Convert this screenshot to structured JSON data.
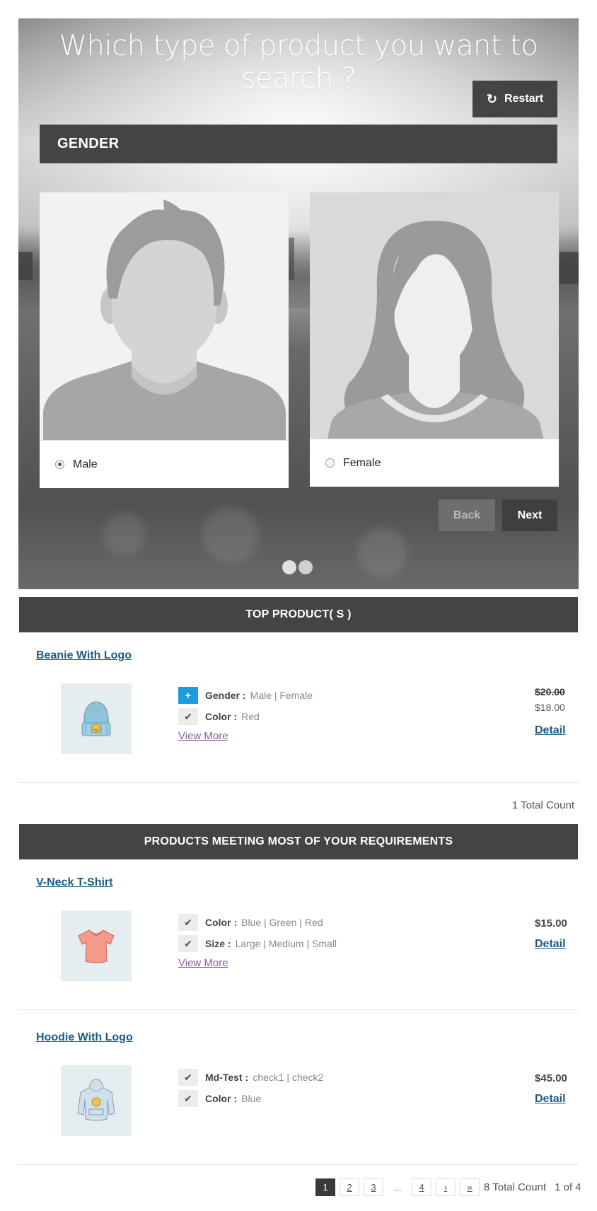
{
  "wizard": {
    "title": "Which type of product you want to search ?",
    "restart_label": "Restart",
    "question": "GENDER",
    "options": [
      {
        "label": "Male",
        "selected": true
      },
      {
        "label": "Female",
        "selected": false
      }
    ],
    "back_label": "Back",
    "next_label": "Next",
    "steps_total": 2,
    "step_active": 1
  },
  "top_products": {
    "heading": "TOP PRODUCT( S )",
    "items": [
      {
        "title": "Beanie With Logo",
        "image_icon": "beanie-image",
        "attributes": [
          {
            "key": "Gender :",
            "value": "Male | Female",
            "marker": "+"
          },
          {
            "key": "Color :",
            "value": "Red",
            "marker": "✔"
          }
        ],
        "view_more": "View More",
        "price_old": "$20.00",
        "price_new": "$18.00",
        "detail": "Detail"
      }
    ],
    "total_count": "1 Total Count"
  },
  "matching_products": {
    "heading": "PRODUCTS MEETING MOST OF YOUR REQUIREMENTS",
    "items": [
      {
        "title": "V-Neck T-Shirt",
        "image_icon": "tshirt-image",
        "attributes": [
          {
            "key": "Color :",
            "value": "Blue | Green | Red",
            "marker": "✔"
          },
          {
            "key": "Size :",
            "value": "Large | Medium | Small",
            "marker": "✔"
          }
        ],
        "view_more": "View More",
        "price": "$15.00",
        "detail": "Detail"
      },
      {
        "title": "Hoodie With Logo",
        "image_icon": "hoodie-image",
        "attributes": [
          {
            "key": "Md-Test :",
            "value": "check1 | check2",
            "marker": "✔"
          },
          {
            "key": "Color :",
            "value": "Blue",
            "marker": "✔"
          }
        ],
        "price": "$45.00",
        "detail": "Detail"
      }
    ],
    "pagination": {
      "pages": [
        "1",
        "2",
        "3",
        "...",
        "4",
        "›",
        "»"
      ],
      "current": "1",
      "total_count": "8 Total Count",
      "page_of": "1 of 4"
    }
  },
  "colors": {
    "dark_bar": "#444444",
    "link_blue": "#1e5b84",
    "plus_blue": "#1a9de0",
    "view_more_purple": "#8b5a9a"
  }
}
